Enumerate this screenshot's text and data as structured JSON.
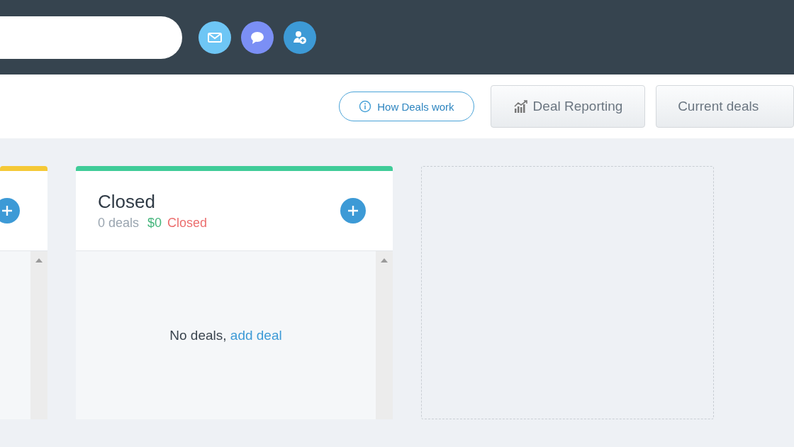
{
  "top_bar": {
    "icons": [
      {
        "kind": "mail",
        "color": "#6ec6f5"
      },
      {
        "kind": "chat",
        "color": "#7b8ff5"
      },
      {
        "kind": "add-user",
        "color": "#3d9ad6"
      }
    ]
  },
  "toolbar": {
    "help_link": "How Deals work",
    "reporting_button": "Deal Reporting",
    "view_select": "Current deals"
  },
  "stages": [
    {
      "kind": "partial",
      "color": "#f5c936"
    },
    {
      "kind": "full",
      "color": "#3fcc98",
      "title": "Closed",
      "deal_count": "0 deals",
      "amount": "$0",
      "amount_label": "Closed",
      "empty_text": "No deals,",
      "empty_link": "add deal"
    }
  ]
}
